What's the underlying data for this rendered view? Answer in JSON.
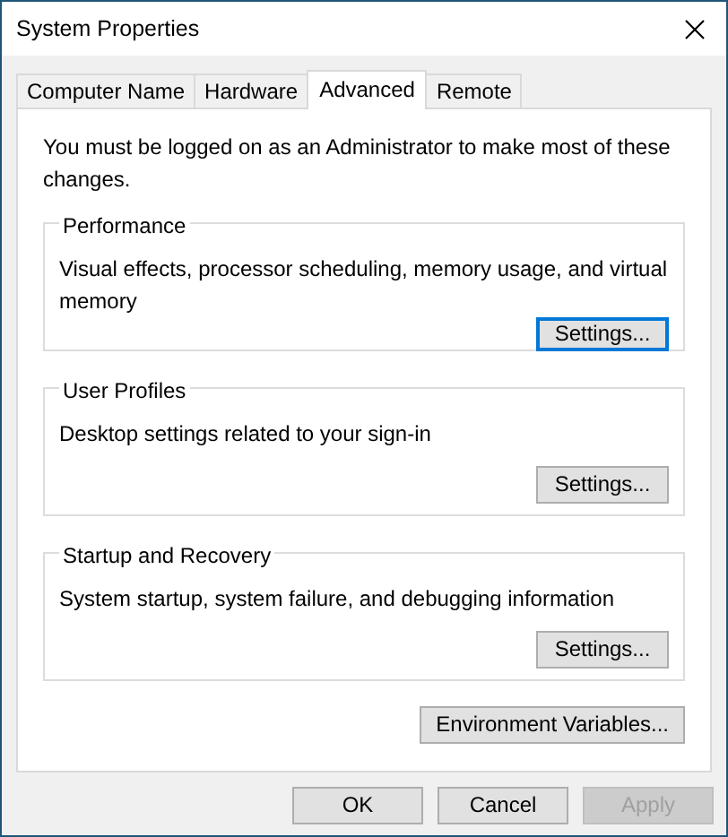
{
  "window": {
    "title": "System Properties"
  },
  "tabs": [
    {
      "label": "Computer Name",
      "selected": false
    },
    {
      "label": "Hardware",
      "selected": false
    },
    {
      "label": "Advanced",
      "selected": true
    },
    {
      "label": "Remote",
      "selected": false
    }
  ],
  "notice": "You must be logged on as an Administrator to make most of these changes.",
  "groups": [
    {
      "title": "Performance",
      "description": "Visual effects, processor scheduling, memory usage, and virtual memory",
      "button": {
        "label": "Settings...",
        "focused": true
      }
    },
    {
      "title": "User Profiles",
      "description": "Desktop settings related to your sign-in",
      "button": {
        "label": "Settings...",
        "focused": false
      }
    },
    {
      "title": "Startup and Recovery",
      "description": "System startup, system failure, and debugging information",
      "button": {
        "label": "Settings...",
        "focused": false
      }
    }
  ],
  "environment_button": {
    "label": "Environment Variables..."
  },
  "buttons": [
    {
      "label": "OK",
      "disabled": false
    },
    {
      "label": "Cancel",
      "disabled": false
    },
    {
      "label": "Apply",
      "disabled": true
    }
  ]
}
